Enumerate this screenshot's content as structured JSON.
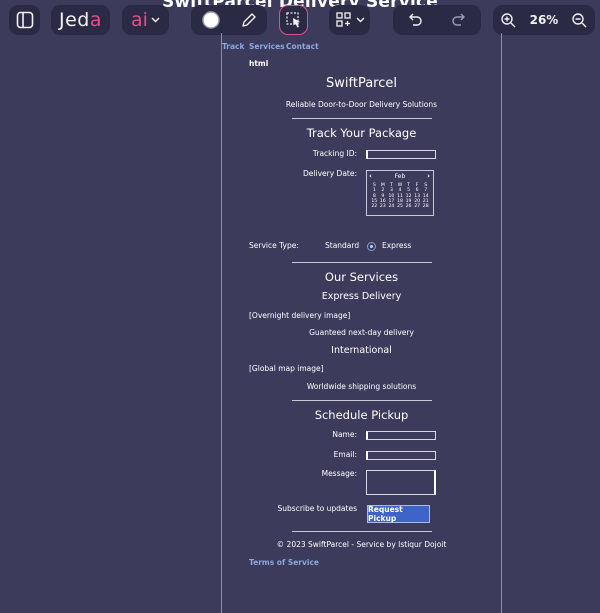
{
  "app": {
    "document_title": "SwiftParcel Delivery Service",
    "brand_prefix": "Jed",
    "brand_accent": "a",
    "ai_label": "ai",
    "zoom": "26%"
  },
  "nav": {
    "track": "Track",
    "services": "Services",
    "contact": "Contact"
  },
  "page": {
    "tag_label": "html",
    "title": "SwiftParcel",
    "subtitle": "Reliable Door-to-Door Delivery Solutions",
    "track": {
      "heading": "Track Your Package",
      "tracking_label": "Tracking ID:",
      "tracking_value": "",
      "delivery_label": "Delivery Date:",
      "calendar": {
        "month": "Feb",
        "weekdays": [
          "S",
          "M",
          "T",
          "W",
          "T",
          "F",
          "S"
        ],
        "days": [
          "1",
          "2",
          "3",
          "4",
          "5",
          "6",
          "7",
          "8",
          "9",
          "10",
          "11",
          "12",
          "13",
          "14",
          "15",
          "16",
          "17",
          "18",
          "19",
          "20",
          "21",
          "22",
          "23",
          "24",
          "25",
          "26",
          "27",
          "28"
        ]
      },
      "service_label": "Service Type:",
      "option_standard": "Standard",
      "option_express": "Express",
      "selected_option": "Express"
    },
    "services": {
      "heading": "Our Services",
      "express_title": "Express Delivery",
      "express_image": "[Overnight delivery image]",
      "express_desc": "Guanteed next-day delivery",
      "international_title": "International",
      "international_image": "[Global map image]",
      "international_desc": "Worldwide shipping solutions"
    },
    "pickup": {
      "heading": "Schedule Pickup",
      "name_label": "Name:",
      "name_value": "",
      "email_label": "Email:",
      "email_value": "",
      "message_label": "Message:",
      "message_value": "",
      "subscribe_label": "Subscribe to updates",
      "submit_label": "Request Pickup"
    },
    "footer": {
      "copyright": "© 2023 SwiftParcel - Service by Istiqur Dojoit",
      "terms": "Terms of Service"
    }
  },
  "colors": {
    "background": "#3c3b5c",
    "toolbar": "#2b2a44",
    "accent": "#e34f8a",
    "link": "#8aa8dd",
    "button": "#3e64c8"
  }
}
